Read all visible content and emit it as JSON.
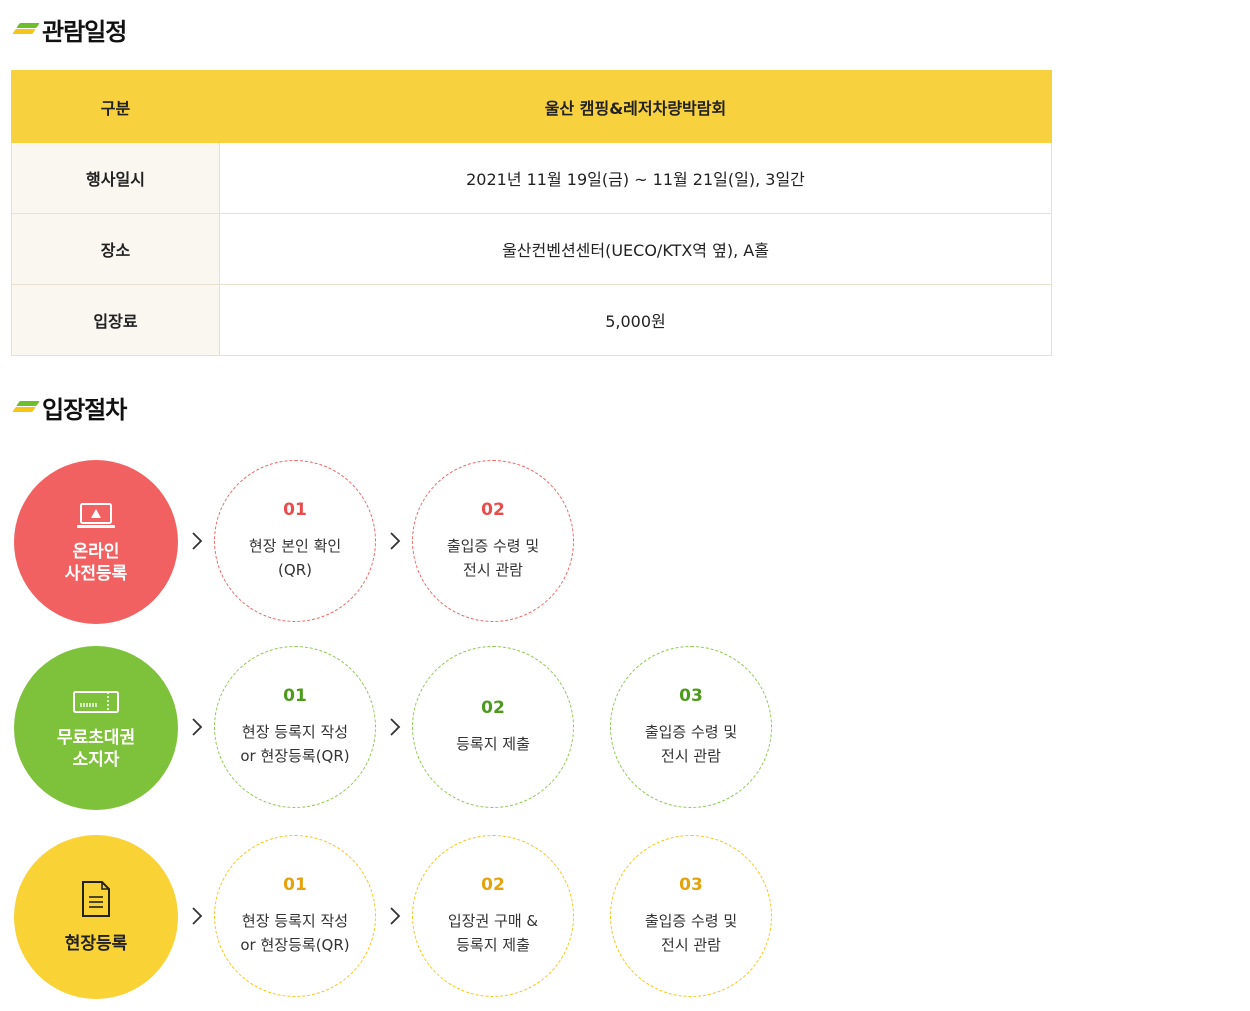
{
  "schedule": {
    "title": "관람일정",
    "header": {
      "label": "구분",
      "value": "울산 캠핑&레저차량박람회"
    },
    "rows": [
      {
        "label": "행사일시",
        "value": "2021년 11월 19일(금) ~ 11월 21일(일), 3일간"
      },
      {
        "label": "장소",
        "value": "울산컨벤션센터(UECO/KTX역 옆), A홀"
      },
      {
        "label": "입장료",
        "value": "5,000원"
      }
    ]
  },
  "procedure": {
    "title": "입장절차",
    "flows": [
      {
        "name_line1": "온라인",
        "name_line2": "사전등록",
        "icon": "laptop-icon",
        "color": "#f26161",
        "steps": [
          {
            "num": "01",
            "line1": "현장 본인 확인",
            "line2": "(QR)"
          },
          {
            "num": "02",
            "line1": "출입증 수령 및",
            "line2": "전시 관람"
          }
        ]
      },
      {
        "name_line1": "무료초대권",
        "name_line2": "소지자",
        "icon": "ticket-icon",
        "color": "#7ec13a",
        "steps": [
          {
            "num": "01",
            "line1": "현장 등록지 작성",
            "line2": "or 현장등록(QR)"
          },
          {
            "num": "02",
            "line1": "등록지 제출",
            "line2": ""
          },
          {
            "num": "03",
            "line1": "출입증 수령 및",
            "line2": "전시 관람"
          }
        ]
      },
      {
        "name_line1": "",
        "name_line2": "현장등록",
        "icon": "document-icon",
        "color": "#f9d235",
        "steps": [
          {
            "num": "01",
            "line1": "현장 등록지 작성",
            "line2": "or 현장등록(QR)"
          },
          {
            "num": "02",
            "line1": "입장권 구매 &",
            "line2": "등록지 제출"
          },
          {
            "num": "03",
            "line1": "출입증 수령 및",
            "line2": "전시 관람"
          }
        ]
      }
    ]
  }
}
